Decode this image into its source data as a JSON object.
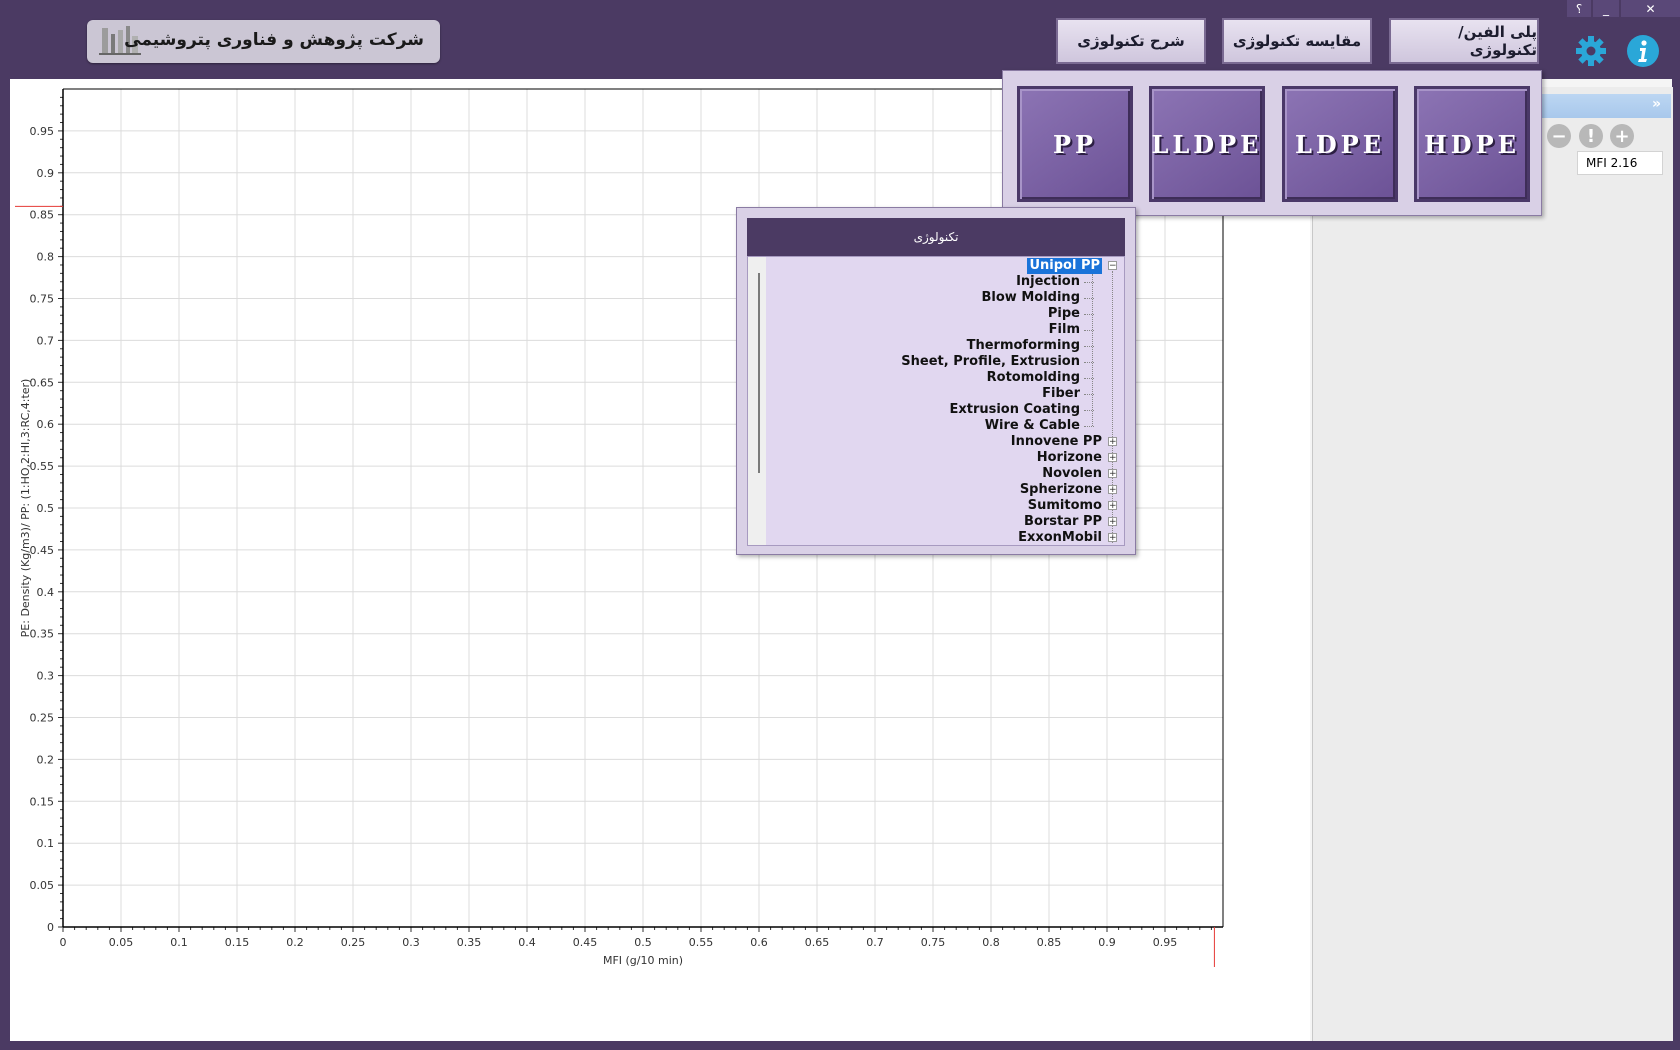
{
  "window_controls": {
    "help": "؟",
    "minimize": "_",
    "close": "✕"
  },
  "header": {
    "company_name": "شرکت پژوهش و فناوری پتروشیمی",
    "buttons": {
      "polyolefin_technology": "پلی الفین/تکنولوژی",
      "technology_comparison": "مقایسه تکنولوژی",
      "technology_description": "شرح تکنولوژی"
    }
  },
  "polymer_menu": {
    "items": [
      "PP",
      "LLDPE",
      "LDPE",
      "HDPE"
    ]
  },
  "technology_panel": {
    "title": "تکنولوژی",
    "tree": [
      {
        "label": "Unipol PP",
        "expanded": true,
        "selected": true,
        "children": [
          "Injection",
          "Blow Molding",
          "Pipe",
          "Film",
          "Thermoforming",
          "Sheet, Profile, Extrusion",
          "Rotomolding",
          "Fiber",
          "Extrusion Coating",
          "Wire & Cable"
        ]
      },
      {
        "label": "Innovene PP",
        "expanded": false
      },
      {
        "label": "Horizone",
        "expanded": false
      },
      {
        "label": "Novolen",
        "expanded": false
      },
      {
        "label": "Spherizone",
        "expanded": false
      },
      {
        "label": "Sumitomo",
        "expanded": false
      },
      {
        "label": "Borstar PP",
        "expanded": false
      },
      {
        "label": "ExxonMobil",
        "expanded": false
      }
    ]
  },
  "right_panel": {
    "collapse_icon": "»",
    "column_header": "MFI 2.16"
  },
  "chart_data": {
    "type": "scatter",
    "xlabel": "MFI (g/10 min)",
    "ylabel": "PE: Density (Kg/m3)/ PP: (1:HO,2:HI,3:RC,4:ter)",
    "xlim": [
      0,
      1
    ],
    "ylim": [
      0,
      1
    ],
    "x_ticks": [
      "0",
      "0.05",
      "0.1",
      "0.15",
      "0.2",
      "0.25",
      "0.3",
      "0.35",
      "0.4",
      "0.45",
      "0.5",
      "0.55",
      "0.6",
      "0.65",
      "0.7",
      "0.75",
      "0.8",
      "0.85",
      "0.9",
      "0.95"
    ],
    "y_ticks": [
      "0",
      "0.05",
      "0.1",
      "0.15",
      "0.2",
      "0.25",
      "0.3",
      "0.35",
      "0.4",
      "0.45",
      "0.5",
      "0.55",
      "0.6",
      "0.65",
      "0.7",
      "0.75",
      "0.8",
      "0.85",
      "0.9",
      "0.95"
    ],
    "grid": true,
    "series": [],
    "cursor_x": 0.99,
    "cursor_y": 0.86,
    "cursor_color": "#e53935"
  }
}
